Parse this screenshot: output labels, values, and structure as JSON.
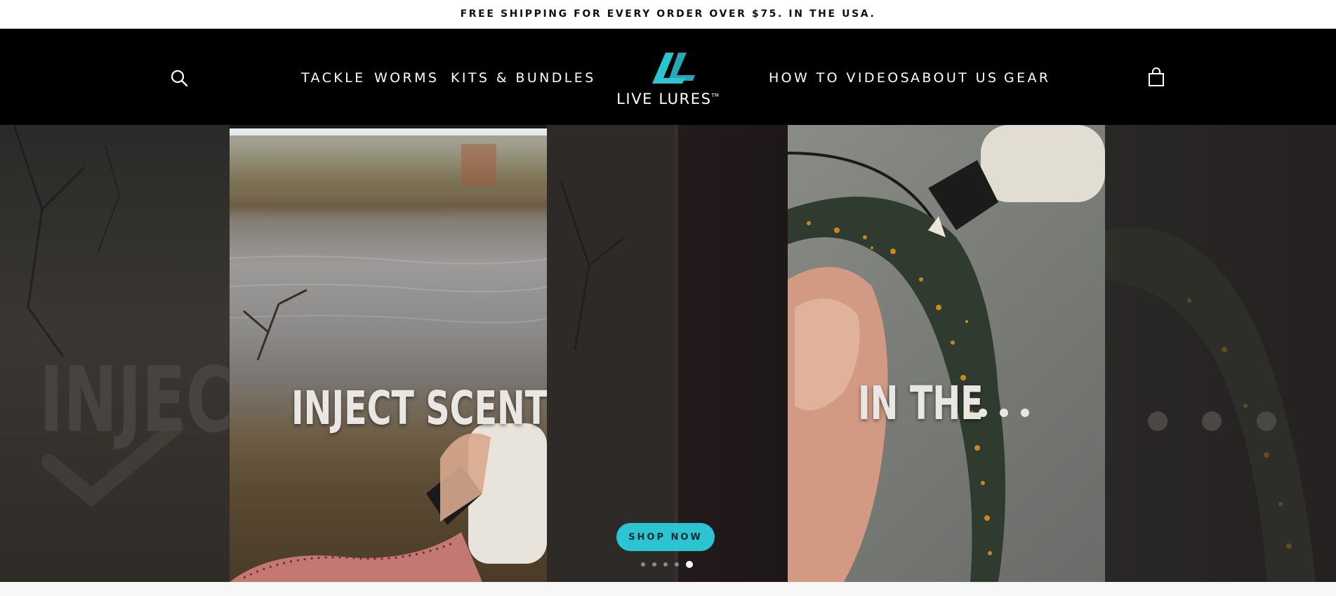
{
  "announcement": {
    "text": "FREE SHIPPING FOR EVERY ORDER OVER $75. IN THE USA."
  },
  "header": {
    "search_icon": "search-icon",
    "cart_icon": "shopping-bag-icon",
    "nav_left": [
      {
        "label": "TACKLE"
      },
      {
        "label": "WORMS"
      },
      {
        "label": "KITS & BUNDLES"
      }
    ],
    "nav_right": [
      {
        "label": "HOW TO VIDEOS"
      },
      {
        "label": "ABOUT US"
      },
      {
        "label": "GEAR"
      }
    ],
    "logo": {
      "text": "LIVE LURES",
      "trademark": "TM"
    }
  },
  "hero": {
    "slides": [
      {
        "heading": "INJECT SCENT"
      },
      {
        "heading": "IN THE"
      }
    ],
    "faded_heading": "INJEC",
    "shop_now_label": "SHOP NOW",
    "pagination": {
      "count": 5,
      "active_index": 4
    }
  },
  "colors": {
    "accent": "#2bc4d3",
    "header_bg": "#000000",
    "announcement_bg": "#ffffff"
  }
}
